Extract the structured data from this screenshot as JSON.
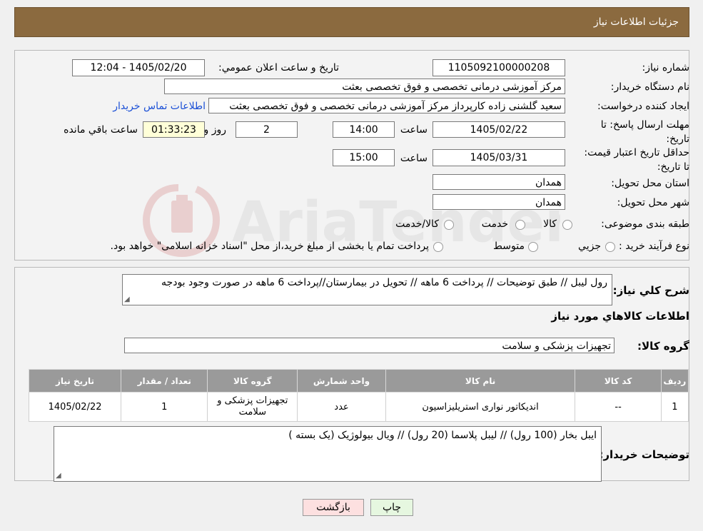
{
  "header": {
    "title": "جزئیات اطلاعات نیاز"
  },
  "form": {
    "need_number_label": "شماره نیاز:",
    "need_number": "1105092100000208",
    "announce_label": "تاریخ و ساعت اعلان عمومي:",
    "announce_value": "1405/02/20 - 12:04",
    "buyer_org_label": "نام دستگاه خریدار:",
    "buyer_org": "مرکز آموزشی درمانی تخصصی و فوق تخصصی بعثت",
    "creator_label": "ایجاد کننده درخواست:",
    "creator": "سعید گلشنی زاده کارپرداز مرکز آموزشی درمانی تخصصی و فوق تخصصی بعثت",
    "contact_link": "اطلاعات تماس خریدار",
    "deadline_label": "مهلت ارسال پاسخ: تا تاریخ:",
    "deadline_date": "1405/02/22",
    "time_label": "ساعت",
    "deadline_time": "14:00",
    "days_value": "2",
    "days_label": "روز و",
    "remaining_time": "01:33:23",
    "remaining_label": "ساعت باقي مانده",
    "validity_label": "حداقل تاریخ اعتبار قیمت: تا تاریخ:",
    "validity_date": "1405/03/31",
    "validity_time": "15:00",
    "province_label": "استان محل تحویل:",
    "province": "همدان",
    "city_label": "شهر محل تحویل:",
    "city": "همدان",
    "category_label": "طبقه بندی موضوعی:",
    "category_options": [
      "کالا",
      "خدمت",
      "کالا/خدمت"
    ],
    "process_label": "نوع فرآیند خرید :",
    "process_options": [
      "جزیي",
      "متوسط"
    ],
    "process_note": "پرداخت تمام یا بخشی از مبلغ خرید،از محل \"اسناد خزانه اسلامی\" خواهد بود."
  },
  "details": {
    "desc_label": "شرح کلي نیاز:",
    "desc_text": "رول لیبل // طبق توضیحات  // پرداخت 6 ماهه // تحویل در بیمارستان//پرداخت 6 ماهه در صورت وجود بودجه",
    "goods_info_title": "اطلاعات کالاهاي مورد نياز",
    "goods_group_label": "گروه کالا:",
    "goods_group": "تجهیزات پزشکی و سلامت"
  },
  "table": {
    "headers": [
      "رديف",
      "کد کالا",
      "نام کالا",
      "واحد شمارش",
      "گروه کالا",
      "تعداد / مقدار",
      "تاريخ نياز"
    ],
    "rows": [
      [
        "1",
        "--",
        "اندیکاتور نواری استریلیزاسیون",
        "عدد",
        "تجهیزات پزشکی و سلامت",
        "1",
        "1405/02/22"
      ]
    ]
  },
  "buyer_notes": {
    "label": "توضیحات خریدار:",
    "text": "ایبل بخار (100 رول) // لیبل پلاسما (20 رول) // ویال بیولوژیک (یک بسته )"
  },
  "buttons": {
    "print": "چاپ",
    "back": "بازگشت"
  },
  "watermark": {
    "text": "AriaTender.neT"
  },
  "colors": {
    "header": "#8b6a3f",
    "link": "#1a4fd6",
    "back_button": "#fde0e0",
    "print_button": "#e6f7e0"
  }
}
